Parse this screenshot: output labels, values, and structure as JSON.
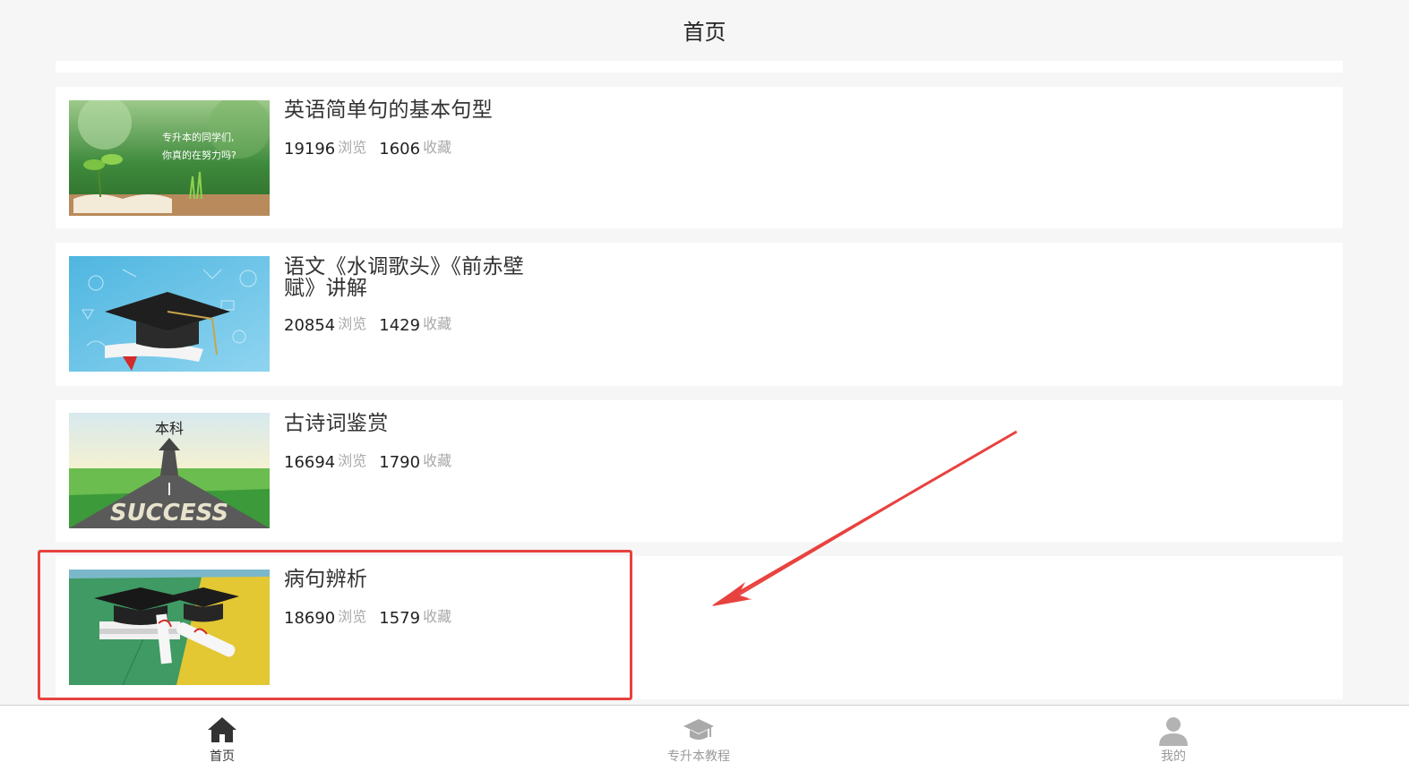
{
  "header": {
    "title": "首页"
  },
  "articles": [
    {
      "title": "英语简单句的基本句型",
      "views": "19196",
      "views_unit": "浏览",
      "favs": "1606",
      "favs_unit": "收藏",
      "thumb_text": [
        "专升本的同学们,",
        "你真的在努力吗?"
      ]
    },
    {
      "title": "语文《水调歌头》《前赤壁赋》讲解",
      "views": "20854",
      "views_unit": "浏览",
      "favs": "1429",
      "favs_unit": "收藏"
    },
    {
      "title": "古诗词鉴赏",
      "views": "16694",
      "views_unit": "浏览",
      "favs": "1790",
      "favs_unit": "收藏",
      "thumb_text": [
        "本科",
        "SUCCESS"
      ]
    },
    {
      "title": "病句辨析",
      "views": "18690",
      "views_unit": "浏览",
      "favs": "1579",
      "favs_unit": "收藏"
    }
  ],
  "tabs": [
    {
      "label": "首页",
      "icon": "home-icon",
      "active": true
    },
    {
      "label": "专升本教程",
      "icon": "graduation-cap-icon",
      "active": false
    },
    {
      "label": "我的",
      "icon": "user-icon",
      "active": false
    }
  ],
  "colors": {
    "highlight": "#e8423f",
    "active_tab": "#333333",
    "inactive_tab": "#9a9a9a",
    "unit_gray": "#a9a9a9"
  }
}
